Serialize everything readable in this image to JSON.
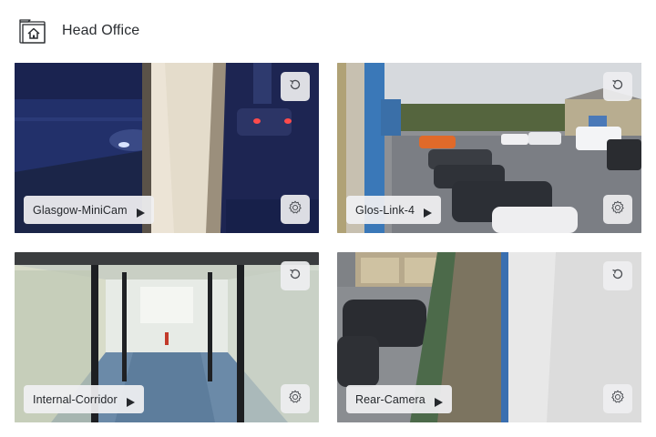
{
  "header": {
    "title": "Head Office",
    "icon": "home-folder-icon"
  },
  "cameras": [
    {
      "name": "Glasgow-MiniCam",
      "scene": "night car park through window"
    },
    {
      "name": "Glos-Link-4",
      "scene": "daytime car park"
    },
    {
      "name": "Internal-Corridor",
      "scene": "office corridor"
    },
    {
      "name": "Rear-Camera",
      "scene": "rear yard with parked cars"
    }
  ],
  "controls": {
    "refresh_icon": "refresh-icon",
    "settings_icon": "gear-icon",
    "play_icon": "play-icon"
  }
}
